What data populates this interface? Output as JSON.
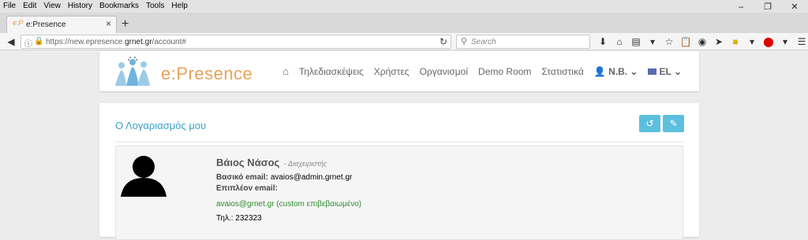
{
  "menubar": {
    "items": [
      "File",
      "Edit",
      "View",
      "History",
      "Bookmarks",
      "Tools",
      "Help"
    ]
  },
  "tab": {
    "title": "e:Presence",
    "favicon": "e:P"
  },
  "address": {
    "prefix": "https://new.epresence.",
    "domain": "grnet.gr",
    "path": "/account#"
  },
  "search": {
    "placeholder": "Search"
  },
  "site": {
    "logo_text": "e:Presence",
    "nav": [
      "Τηλεδιασκέψεις",
      "Χρήστες",
      "Οργανισμοί",
      "Demo Room",
      "Στατιστικά"
    ],
    "user_label": "N.B.",
    "lang_label": "EL"
  },
  "account": {
    "title": "Ο Λογαριασμός μου",
    "name": "Βάιος Νάσος",
    "role": "- Διαχειριστής",
    "primary_email_label": "Βασικό email:",
    "primary_email": "avaios@admin.grnet.gr",
    "extra_email_label": "Επιπλέον email:",
    "extra_email": "avaios@grnet.gr (custom επιβεβαιωμένο)",
    "phone": "Τηλ.: 232323"
  },
  "colors": {
    "accent": "#3aa0cc",
    "button": "#5bc0de",
    "logo": "#e8a25a"
  }
}
